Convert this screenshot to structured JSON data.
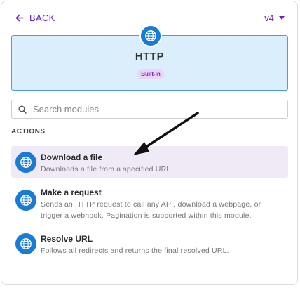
{
  "header": {
    "back_label": "BACK",
    "version": "v4"
  },
  "app": {
    "name": "HTTP",
    "badge": "Built-in",
    "icon": "globe-icon",
    "accent_color": "#1a7bd4",
    "brand_color": "#6b1fbf"
  },
  "search": {
    "placeholder": "Search modules",
    "value": ""
  },
  "section": {
    "label": "ACTIONS"
  },
  "modules": [
    {
      "title": "Download a file",
      "description": "Downloads a file from a specified URL.",
      "selected": true
    },
    {
      "title": "Make a request",
      "description": "Sends an HTTP request to call any API, download a webpage, or trigger a webhook. Pagination is supported within this module.",
      "selected": false
    },
    {
      "title": "Resolve URL",
      "description": "Follows all redirects and returns the final resolved URL.",
      "selected": false
    }
  ]
}
